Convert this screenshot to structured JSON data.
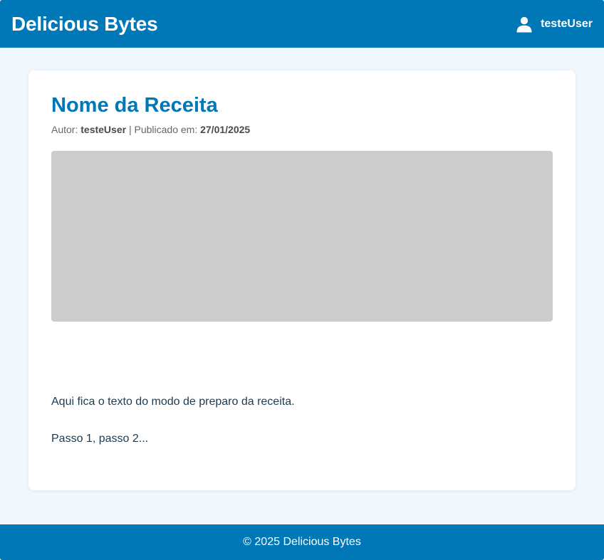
{
  "header": {
    "brand": "Delicious Bytes",
    "user": {
      "icon": "user-icon",
      "name": "testeUser"
    }
  },
  "recipe": {
    "title": "Nome da Receita",
    "author_label": "Autor:",
    "author": "testeUser",
    "separator": "|",
    "published_label": "Publicado em:",
    "published_date": "27/01/2025",
    "paragraphs": [
      "Aqui fica o texto do modo de preparo da receita.",
      "Passo 1, passo 2..."
    ]
  },
  "footer": {
    "text": "© 2025 Delicious Bytes"
  },
  "colors": {
    "primary": "#0077b6",
    "background": "#f0f7fd",
    "card": "#ffffff",
    "image_placeholder": "#cccccc"
  }
}
